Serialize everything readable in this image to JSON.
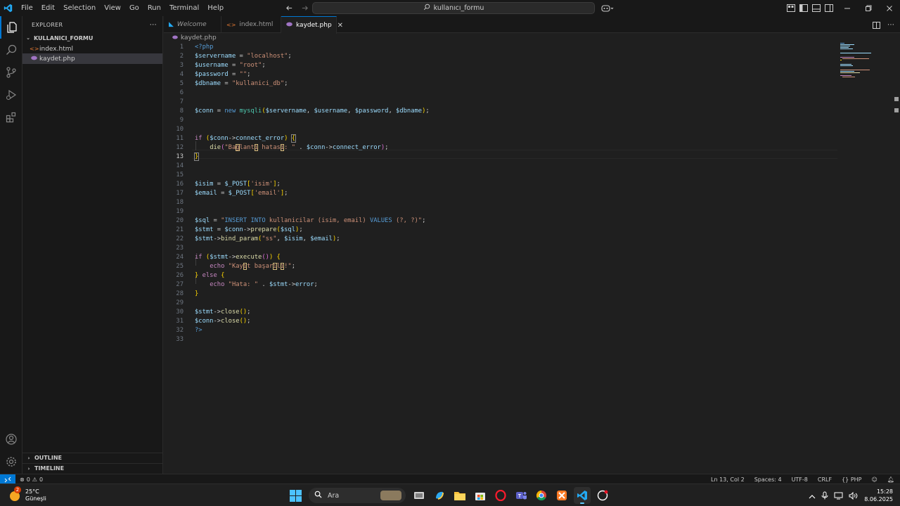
{
  "menu": [
    "File",
    "Edit",
    "Selection",
    "View",
    "Go",
    "Run",
    "Terminal",
    "Help"
  ],
  "search": {
    "text": "kullanıcı_formu"
  },
  "explorer": {
    "title": "EXPLORER",
    "folder": "KULLANICI_FORMU",
    "files": [
      {
        "name": "index.html",
        "icon": "html-file-icon"
      },
      {
        "name": "kaydet.php",
        "icon": "php-file-icon"
      }
    ],
    "outline": "OUTLINE",
    "timeline": "TIMELINE"
  },
  "tabs": [
    {
      "label": "Welcome"
    },
    {
      "label": "index.html"
    },
    {
      "label": "kaydet.php"
    }
  ],
  "breadcrumb": "kaydet.php",
  "line_numbers": [
    "1",
    "2",
    "3",
    "4",
    "5",
    "6",
    "7",
    "8",
    "9",
    "10",
    "11",
    "12",
    "13",
    "14",
    "15",
    "16",
    "17",
    "18",
    "19",
    "20",
    "21",
    "22",
    "23",
    "24",
    "25",
    "26",
    "27",
    "28",
    "29",
    "30",
    "31",
    "32",
    "33"
  ],
  "current_line": 13,
  "code_lines": [
    "<?php",
    "$servername = \"localhost\";",
    "$username = \"root\";",
    "$password = \"\";",
    "$dbname = \"kullanici_db\";",
    "",
    "",
    "$conn = new mysqli($servername, $username, $password, $dbname);",
    "",
    "",
    "if ($conn->connect_error) {",
    "    die(\"Bağlantı hatası: \" . $conn->connect_error);",
    "}",
    "",
    "",
    "$isim = $_POST['isim'];",
    "$email = $_POST['email'];",
    "",
    "",
    "$sql = \"INSERT INTO kullanicilar (isim, email) VALUES (?, ?)\";",
    "$stmt = $conn->prepare($sql);",
    "$stmt->bind_param(\"ss\", $isim, $email);",
    "",
    "if ($stmt->execute()) {",
    "    echo \"Kayıt başarılı!\";",
    "} else {",
    "    echo \"Hata: \" . $stmt->error;",
    "}",
    "",
    "$stmt->close();",
    "$conn->close();",
    "?>",
    ""
  ],
  "status": {
    "errors": "0",
    "warnings": "0",
    "position": "Ln 13, Col 2",
    "spaces": "Spaces: 4",
    "encoding": "UTF-8",
    "eol": "CRLF",
    "language": "PHP"
  },
  "taskbar": {
    "weather_temp": "25°C",
    "weather_desc": "Güneşli",
    "weather_badge": "2",
    "search_label": "Ara",
    "time": "15:28",
    "date": "8.06.2025"
  },
  "colors": {
    "accent": "#0078d4",
    "keyword": "#569cd6",
    "control": "#c586c0",
    "variable": "#9cdcfe",
    "string": "#ce9178",
    "function": "#dcdcaa"
  }
}
